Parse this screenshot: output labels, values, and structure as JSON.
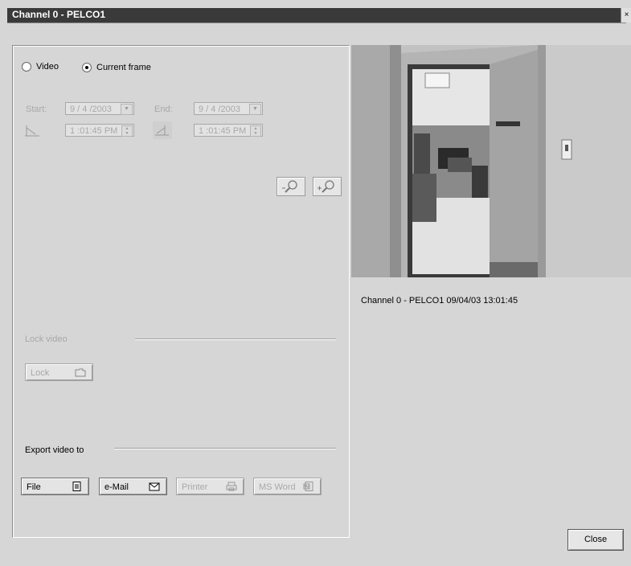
{
  "window": {
    "title": "Channel 0 - PELCO1",
    "close_glyph": "×"
  },
  "source": {
    "options": [
      {
        "label": "Video",
        "selected": false
      },
      {
        "label": "Current frame",
        "selected": true
      }
    ]
  },
  "range": {
    "start_label": "Start:",
    "start_date": "9 / 4 /2003",
    "start_time": "1 :01:45 PM",
    "end_label": "End:",
    "end_date": "9 / 4 /2003",
    "end_time": "1 :01:45 PM"
  },
  "zoom": {
    "out_icon": "zoom-out-icon",
    "in_icon": "zoom-in-icon"
  },
  "lock": {
    "section_label": "Lock video",
    "button_label": "Lock"
  },
  "export": {
    "section_label": "Export video to",
    "buttons": [
      {
        "label": "File",
        "icon": "file-icon",
        "enabled": true
      },
      {
        "label": "e-Mail",
        "icon": "envelope-icon",
        "enabled": true
      },
      {
        "label": "Printer",
        "icon": "printer-icon",
        "enabled": false
      },
      {
        "label": "MS Word",
        "icon": "word-doc-icon",
        "enabled": false
      }
    ]
  },
  "preview": {
    "caption": "Channel 0 - PELCO1 09/04/03 13:01:45"
  },
  "footer": {
    "close_label": "Close"
  },
  "colors": {
    "titlebar": "#3a3a3a",
    "background": "#d6d6d6",
    "disabled_text": "#a8a8a8"
  }
}
